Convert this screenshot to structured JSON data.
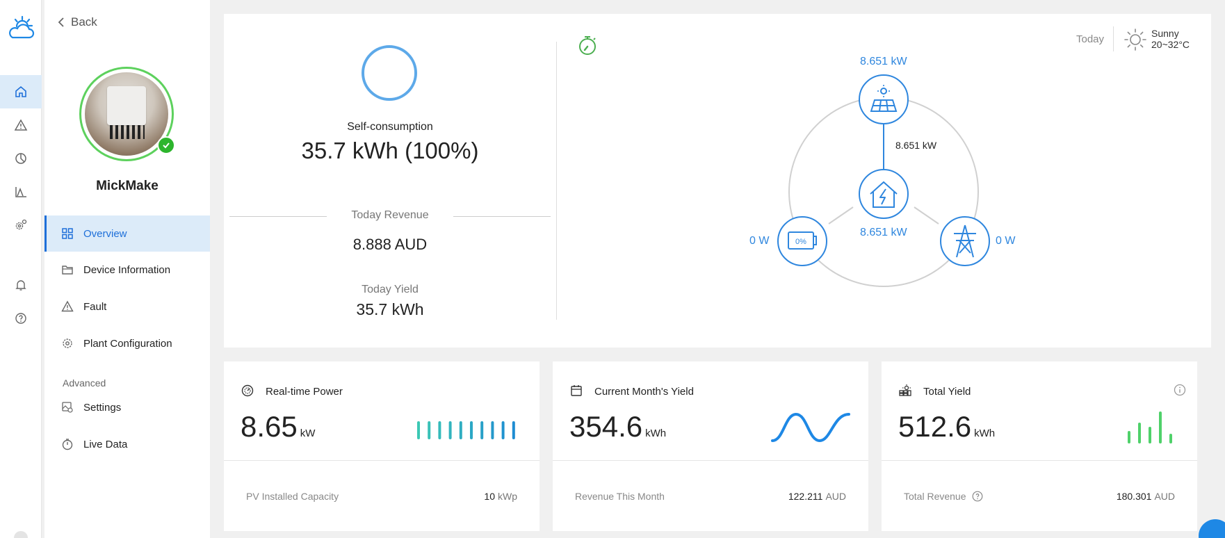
{
  "nav": {
    "back_label": "Back",
    "plant_name": "MickMake",
    "items": [
      {
        "label": "Overview",
        "icon": "grid-icon",
        "active": true
      },
      {
        "label": "Device Information",
        "icon": "folder-icon"
      },
      {
        "label": "Fault",
        "icon": "warning-icon"
      },
      {
        "label": "Plant Configuration",
        "icon": "gear-icon"
      }
    ],
    "section_label": "Advanced",
    "advanced_items": [
      {
        "label": "Settings",
        "icon": "settings-image-icon"
      },
      {
        "label": "Live Data",
        "icon": "timer-icon"
      }
    ]
  },
  "rail": {
    "icons": [
      "cloud-sun-logo",
      "home-icon",
      "alert-icon",
      "pie-chart-icon",
      "area-chart-icon",
      "gears-icon",
      "bell-icon",
      "help-icon"
    ]
  },
  "overview": {
    "self_consumption_label": "Self-consumption",
    "self_consumption_value": "35.7 kWh (100%)",
    "revenue_label": "Today Revenue",
    "revenue_value": "8.888 AUD",
    "yield_label": "Today Yield",
    "yield_value": "35.7 kWh",
    "date_label": "Today",
    "weather_condition": "Sunny",
    "weather_temp": "20~32°C"
  },
  "energy_flow": {
    "pv_power": "8.651 kW",
    "pv_to_home": "8.651 kW",
    "home_power": "8.651 kW",
    "battery_power": "0 W",
    "battery_soc": "0%",
    "grid_power": "0 W"
  },
  "cards": [
    {
      "title": "Real-time Power",
      "icon": "gauge-icon",
      "value": "8.65",
      "unit": "kW",
      "footer_label": "PV Installed Capacity",
      "footer_value": "10",
      "footer_unit": "kWp"
    },
    {
      "title": "Current Month's Yield",
      "icon": "calendar-icon",
      "value": "354.6",
      "unit": "kWh",
      "footer_label": "Revenue This Month",
      "footer_value": "122.211",
      "footer_unit": "AUD"
    },
    {
      "title": "Total Yield",
      "icon": "solar-cluster-icon",
      "value": "512.6",
      "unit": "kWh",
      "footer_label": "Total Revenue",
      "footer_value": "180.301",
      "footer_unit": "AUD"
    }
  ],
  "colors": {
    "accent": "#1e6fd9",
    "flow_blue": "#2e86de",
    "ok_green": "#2db52d",
    "teal": "#3cc8b4",
    "chart_green": "#4fd16a"
  }
}
